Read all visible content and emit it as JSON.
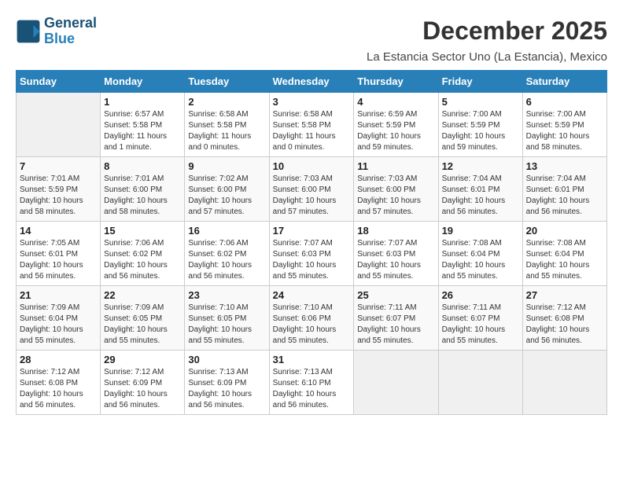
{
  "header": {
    "logo_general": "General",
    "logo_blue": "Blue",
    "month_title": "December 2025",
    "location": "La Estancia Sector Uno (La Estancia), Mexico"
  },
  "days_of_week": [
    "Sunday",
    "Monday",
    "Tuesday",
    "Wednesday",
    "Thursday",
    "Friday",
    "Saturday"
  ],
  "weeks": [
    [
      {
        "num": "",
        "info": ""
      },
      {
        "num": "1",
        "info": "Sunrise: 6:57 AM\nSunset: 5:58 PM\nDaylight: 11 hours and 1 minute."
      },
      {
        "num": "2",
        "info": "Sunrise: 6:58 AM\nSunset: 5:58 PM\nDaylight: 11 hours and 0 minutes."
      },
      {
        "num": "3",
        "info": "Sunrise: 6:58 AM\nSunset: 5:58 PM\nDaylight: 11 hours and 0 minutes."
      },
      {
        "num": "4",
        "info": "Sunrise: 6:59 AM\nSunset: 5:59 PM\nDaylight: 10 hours and 59 minutes."
      },
      {
        "num": "5",
        "info": "Sunrise: 7:00 AM\nSunset: 5:59 PM\nDaylight: 10 hours and 59 minutes."
      },
      {
        "num": "6",
        "info": "Sunrise: 7:00 AM\nSunset: 5:59 PM\nDaylight: 10 hours and 58 minutes."
      }
    ],
    [
      {
        "num": "7",
        "info": "Sunrise: 7:01 AM\nSunset: 5:59 PM\nDaylight: 10 hours and 58 minutes."
      },
      {
        "num": "8",
        "info": "Sunrise: 7:01 AM\nSunset: 6:00 PM\nDaylight: 10 hours and 58 minutes."
      },
      {
        "num": "9",
        "info": "Sunrise: 7:02 AM\nSunset: 6:00 PM\nDaylight: 10 hours and 57 minutes."
      },
      {
        "num": "10",
        "info": "Sunrise: 7:03 AM\nSunset: 6:00 PM\nDaylight: 10 hours and 57 minutes."
      },
      {
        "num": "11",
        "info": "Sunrise: 7:03 AM\nSunset: 6:00 PM\nDaylight: 10 hours and 57 minutes."
      },
      {
        "num": "12",
        "info": "Sunrise: 7:04 AM\nSunset: 6:01 PM\nDaylight: 10 hours and 56 minutes."
      },
      {
        "num": "13",
        "info": "Sunrise: 7:04 AM\nSunset: 6:01 PM\nDaylight: 10 hours and 56 minutes."
      }
    ],
    [
      {
        "num": "14",
        "info": "Sunrise: 7:05 AM\nSunset: 6:01 PM\nDaylight: 10 hours and 56 minutes."
      },
      {
        "num": "15",
        "info": "Sunrise: 7:06 AM\nSunset: 6:02 PM\nDaylight: 10 hours and 56 minutes."
      },
      {
        "num": "16",
        "info": "Sunrise: 7:06 AM\nSunset: 6:02 PM\nDaylight: 10 hours and 56 minutes."
      },
      {
        "num": "17",
        "info": "Sunrise: 7:07 AM\nSunset: 6:03 PM\nDaylight: 10 hours and 55 minutes."
      },
      {
        "num": "18",
        "info": "Sunrise: 7:07 AM\nSunset: 6:03 PM\nDaylight: 10 hours and 55 minutes."
      },
      {
        "num": "19",
        "info": "Sunrise: 7:08 AM\nSunset: 6:04 PM\nDaylight: 10 hours and 55 minutes."
      },
      {
        "num": "20",
        "info": "Sunrise: 7:08 AM\nSunset: 6:04 PM\nDaylight: 10 hours and 55 minutes."
      }
    ],
    [
      {
        "num": "21",
        "info": "Sunrise: 7:09 AM\nSunset: 6:04 PM\nDaylight: 10 hours and 55 minutes."
      },
      {
        "num": "22",
        "info": "Sunrise: 7:09 AM\nSunset: 6:05 PM\nDaylight: 10 hours and 55 minutes."
      },
      {
        "num": "23",
        "info": "Sunrise: 7:10 AM\nSunset: 6:05 PM\nDaylight: 10 hours and 55 minutes."
      },
      {
        "num": "24",
        "info": "Sunrise: 7:10 AM\nSunset: 6:06 PM\nDaylight: 10 hours and 55 minutes."
      },
      {
        "num": "25",
        "info": "Sunrise: 7:11 AM\nSunset: 6:07 PM\nDaylight: 10 hours and 55 minutes."
      },
      {
        "num": "26",
        "info": "Sunrise: 7:11 AM\nSunset: 6:07 PM\nDaylight: 10 hours and 55 minutes."
      },
      {
        "num": "27",
        "info": "Sunrise: 7:12 AM\nSunset: 6:08 PM\nDaylight: 10 hours and 56 minutes."
      }
    ],
    [
      {
        "num": "28",
        "info": "Sunrise: 7:12 AM\nSunset: 6:08 PM\nDaylight: 10 hours and 56 minutes."
      },
      {
        "num": "29",
        "info": "Sunrise: 7:12 AM\nSunset: 6:09 PM\nDaylight: 10 hours and 56 minutes."
      },
      {
        "num": "30",
        "info": "Sunrise: 7:13 AM\nSunset: 6:09 PM\nDaylight: 10 hours and 56 minutes."
      },
      {
        "num": "31",
        "info": "Sunrise: 7:13 AM\nSunset: 6:10 PM\nDaylight: 10 hours and 56 minutes."
      },
      {
        "num": "",
        "info": ""
      },
      {
        "num": "",
        "info": ""
      },
      {
        "num": "",
        "info": ""
      }
    ]
  ]
}
